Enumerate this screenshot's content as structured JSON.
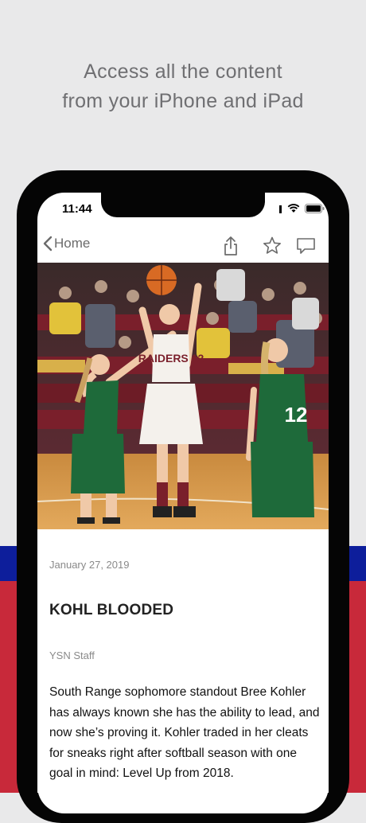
{
  "promo": {
    "line1": "Access all the content",
    "line2": "from your iPhone and iPad"
  },
  "status_bar": {
    "time": "11:44",
    "icons": [
      "signal-icon",
      "wifi-icon",
      "battery-icon"
    ]
  },
  "nav": {
    "back_label": "Home",
    "actions": [
      "share-icon",
      "star-icon",
      "comment-icon"
    ]
  },
  "article": {
    "date": "January 27, 2019",
    "title": "KOHL BLOODED",
    "byline": "YSN Staff",
    "body": "South Range sophomore standout Bree Kohler has always known she has the ability to lead, and now she’s proving it.  Kohler traded in her cleats for sneaks right after softball season with one goal in mind: Level Up from 2018."
  },
  "photo": {
    "jersey_shooter": "RAIDERS 12",
    "jersey_defender": "12"
  },
  "colors": {
    "background": "#e9e9ea",
    "band_blue": "#0d1e9b",
    "band_red": "#c8293a",
    "maroon": "#7a1f2b",
    "green": "#1e6a3a"
  }
}
